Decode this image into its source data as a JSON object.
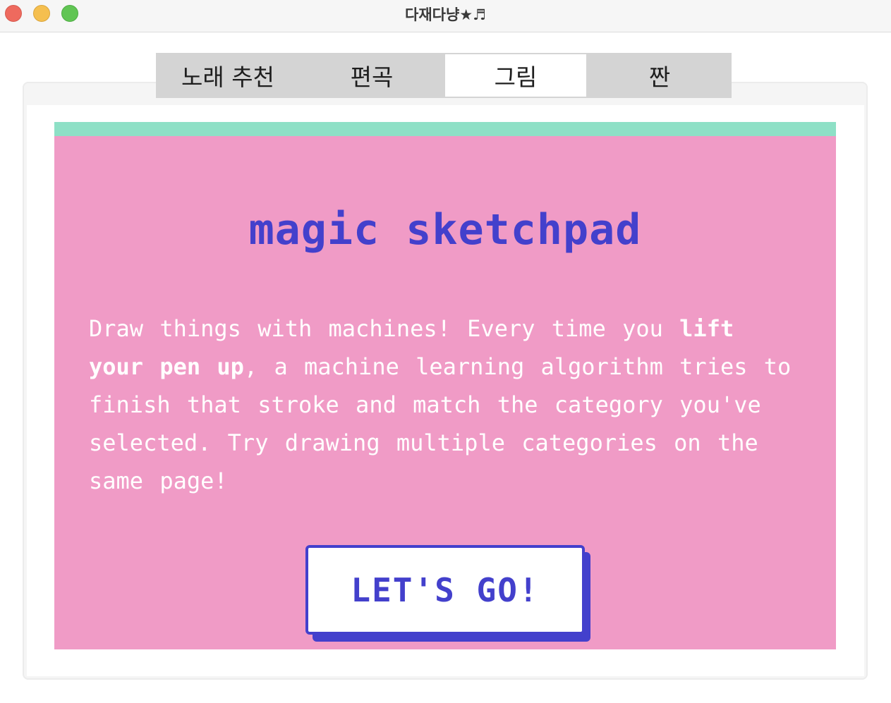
{
  "window": {
    "title": "다재다냥★♬"
  },
  "tabs": [
    {
      "label": "노래 추천",
      "active": false
    },
    {
      "label": "편곡",
      "active": false
    },
    {
      "label": "그림",
      "active": true
    },
    {
      "label": "짠",
      "active": false
    }
  ],
  "card": {
    "title": "magic sketchpad",
    "description_parts": {
      "p1": "Draw things with machines! Every time you ",
      "bold": "lift your pen up",
      "p2": ", a machine learning algorithm tries to finish that stroke and match the category you've selected. Try drawing multiple categories on the same page!"
    },
    "button_label": "LET'S GO!"
  },
  "colors": {
    "card_background": "#f09bc6",
    "card_top_bar": "#8ee0c6",
    "accent": "#4340cc",
    "tab_bar": "#d4d4d4"
  }
}
